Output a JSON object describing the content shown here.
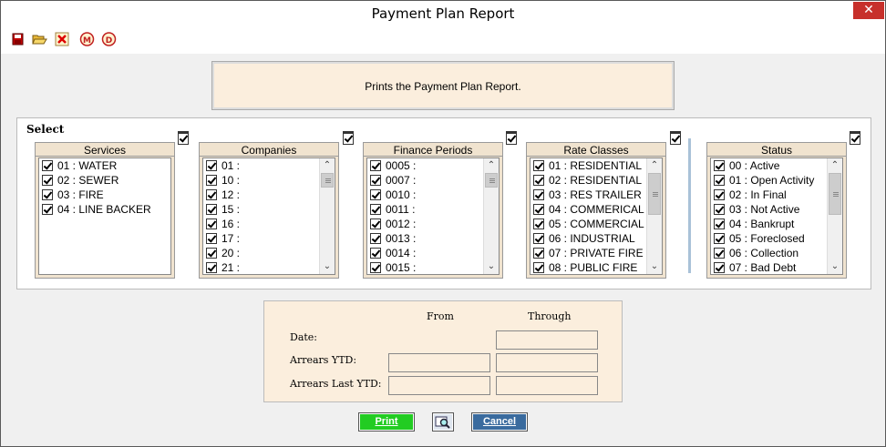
{
  "window": {
    "title": "Payment Plan Report",
    "close_glyph": "✕"
  },
  "toolbar": {
    "icons": [
      "save-icon",
      "open-folder-icon",
      "clear-icon",
      "m-circle-icon",
      "d-circle-icon"
    ],
    "m_label": "M",
    "d_label": "D"
  },
  "description": "Prints the Payment Plan Report.",
  "select": {
    "label": "Select",
    "groups": {
      "services": {
        "title": "Services",
        "items": [
          "01 : WATER",
          "02 : SEWER",
          "03 : FIRE",
          "04 : LINE BACKER"
        ]
      },
      "companies": {
        "title": "Companies",
        "items": [
          "01 :",
          "10 :",
          "12 :",
          "15 :",
          "16 :",
          "17 :",
          "20 :",
          "21 :"
        ]
      },
      "finance_periods": {
        "title": "Finance Periods",
        "items": [
          "0005 :",
          "0007 :",
          "0010 :",
          "0011 :",
          "0012 :",
          "0013 :",
          "0014 :",
          "0015 :"
        ]
      },
      "rate_classes": {
        "title": "Rate Classes",
        "items": [
          "01 : RESIDENTIAL",
          "02 : RESIDENTIAL",
          "03 : RES TRAILER",
          "04 : COMMERICAL",
          "05 : COMMERCIAL",
          "06 : INDUSTRIAL",
          "07 : PRIVATE FIRE",
          "08 : PUBLIC FIRE"
        ]
      },
      "status": {
        "title": "Status",
        "items": [
          "00 : Active",
          "01 : Open Activity",
          "02 : In Final",
          "03 : Not Active",
          "04 : Bankrupt",
          "05 : Foreclosed",
          "06 : Collection",
          "07 : Bad Debt"
        ]
      }
    }
  },
  "range": {
    "from_label": "From",
    "through_label": "Through",
    "date_label": "Date:",
    "arrears_ytd_label": "Arrears YTD:",
    "arrears_last_ytd_label": "Arrears Last YTD:",
    "values": {
      "date_through": "",
      "arrears_ytd_from": "",
      "arrears_ytd_through": "",
      "arrears_last_ytd_from": "",
      "arrears_last_ytd_through": ""
    }
  },
  "buttons": {
    "print": "Print",
    "preview_icon": "magnifier-icon",
    "cancel": "Cancel"
  },
  "colors": {
    "panel_bg": "#f0e3cf",
    "range_bg": "#fbeedd",
    "print_btn": "#22cc22",
    "cancel_btn": "#3a6b9e",
    "close_btn": "#c7302b"
  }
}
